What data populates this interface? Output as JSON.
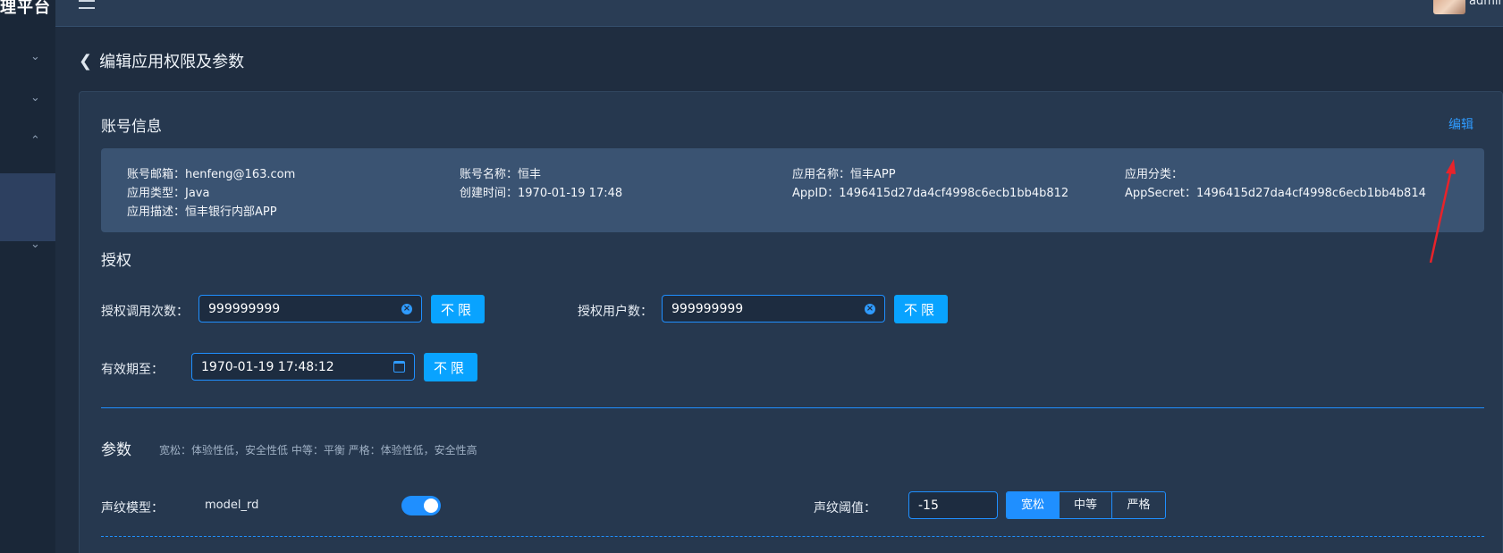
{
  "sidebar": {
    "logo_text": "理平台"
  },
  "topbar": {
    "username": "admin"
  },
  "page": {
    "title": "编辑应用权限及参数"
  },
  "account_section": {
    "title": "账号信息",
    "edit_label": "编辑",
    "info": {
      "email": "账号邮箱：henfeng@163.com",
      "account_name": "账号名称：恒丰",
      "app_name": "应用名称：恒丰APP",
      "app_category": "应用分类：",
      "app_type": "应用类型：Java",
      "created_at": "创建时间：1970-01-19 17:48",
      "app_id": "AppID：1496415d27da4cf4998c6ecb1bb4b812",
      "app_secret": "AppSecret：1496415d27da4cf4998c6ecb1bb4b814",
      "app_desc": "应用描述：恒丰银行内部APP"
    }
  },
  "auth_section": {
    "title": "授权",
    "call_count_label": "授权调用次数：",
    "call_count_value": "999999999",
    "user_count_label": "授权用户数：",
    "user_count_value": "999999999",
    "expiry_label": "有效期至：",
    "expiry_value": "1970-01-19 17:48:12",
    "unlimited_label": "不限"
  },
  "params_section": {
    "title": "参数",
    "hint": "宽松：体验性低，安全性低 中等：平衡 严格：体验性低，安全性高",
    "voice_model_label": "声纹模型：",
    "voice_model_value": "model_rd",
    "voice_model_enabled": true,
    "threshold_label": "声纹阈值：",
    "threshold_value": "-15",
    "strictness_options": [
      "宽松",
      "中等",
      "严格"
    ],
    "strictness_selected": "宽松"
  },
  "colors": {
    "accent": "#1f8fff",
    "button": "#09a3ff",
    "background": "#1f2d40",
    "card": "#26384f",
    "annotation_arrow": "#e8232a"
  }
}
